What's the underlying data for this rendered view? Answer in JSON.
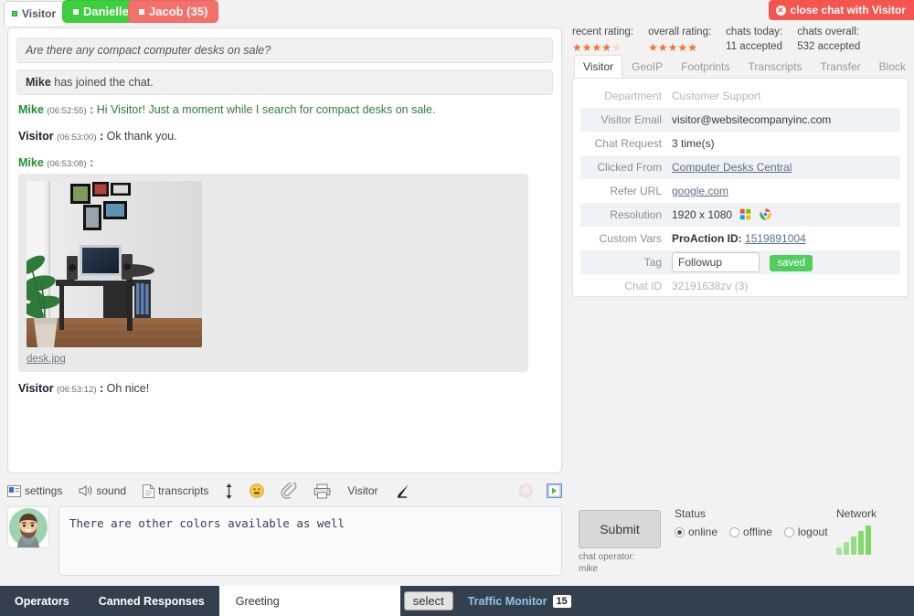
{
  "tabs": {
    "visitor_tab": "Visitor",
    "operators": [
      {
        "name": "Danielle",
        "count": "",
        "label": "Danielle",
        "color": "#3ecf3e"
      },
      {
        "name": "Jacob",
        "count": "35",
        "label": "Jacob (35)",
        "color": "#f4706b"
      }
    ]
  },
  "close_button": {
    "label": "close chat with Visitor",
    "prefix": "close chat with ",
    "strong": "Visitor"
  },
  "stats": {
    "recent_rating_label": "recent rating:",
    "recent_rating_value": 4,
    "overall_rating_label": "overall rating:",
    "overall_rating_value": 5,
    "chats_today_label": "chats today:",
    "chats_today_value": "11 accepted",
    "chats_overall_label": "chats overall:",
    "chats_overall_value": "532 accepted"
  },
  "panel": {
    "tabs": [
      "Visitor",
      "GeoIP",
      "Footprints",
      "Transcripts",
      "Transfer",
      "Block"
    ],
    "active_tab": "Visitor",
    "rows": [
      {
        "key": "Department",
        "value": "Customer Support",
        "muted": true
      },
      {
        "key": "Visitor Email",
        "value": "visitor@websitecompanyinc.com"
      },
      {
        "key": "Chat Request",
        "value": "3 time(s)"
      },
      {
        "key": "Clicked From",
        "value": "Computer Desks Central",
        "link": true
      },
      {
        "key": "Refer URL",
        "value": "google.com",
        "link": true
      },
      {
        "key": "Resolution",
        "value": "1920 x 1080",
        "icons": [
          "os-icon",
          "chrome-icon"
        ]
      },
      {
        "key": "Custom Vars",
        "value": "ProAction ID: ",
        "bold_prefix": "ProAction ID:",
        "link_value": "1519891004"
      },
      {
        "key": "Tag",
        "value": "Followup",
        "input": true,
        "saved_label": "saved"
      },
      {
        "key": "Chat ID",
        "value": "32191638zv  (3)",
        "muted": true
      }
    ]
  },
  "chat": {
    "system_lines": [
      {
        "text": "Are there any compact computer desks on sale?",
        "italic": true
      },
      {
        "who": "Mike",
        "text": " has joined the chat."
      }
    ],
    "messages": [
      {
        "who": "Mike",
        "role": "op",
        "time": "06:52:55",
        "text": "Hi Visitor! Just a moment while I search for compact desks on sale."
      },
      {
        "who": "Visitor",
        "role": "vis",
        "time": "06:53:00",
        "text": "Ok thank you."
      },
      {
        "who": "Mike",
        "role": "op",
        "time": "06:53:08",
        "text": "",
        "attachment": {
          "filename": "desk.jpg",
          "alt": "computer desk photo"
        }
      },
      {
        "who": "Visitor",
        "role": "vis",
        "time": "06:53:12",
        "text": "Oh nice!"
      }
    ]
  },
  "toolbar": {
    "settings": "settings",
    "sound": "sound",
    "transcripts": "transcripts",
    "visitor": "Visitor",
    "icons": [
      "settings-icon",
      "sound-icon",
      "transcripts-icon",
      "resize-icon",
      "emoji-icon",
      "attach-icon",
      "print-icon",
      "pen-icon",
      "bell-icon",
      "push-icon"
    ]
  },
  "composer": {
    "value": "There are other colors available as well",
    "placeholder": ""
  },
  "submit": {
    "label": "Submit",
    "operator_label_line1": "chat operator:",
    "operator_label_line2": "mike"
  },
  "status": {
    "label": "Status",
    "options": [
      {
        "label": "online",
        "selected": true
      },
      {
        "label": "offline",
        "selected": false
      },
      {
        "label": "logout",
        "selected": false
      }
    ]
  },
  "network": {
    "label": "Network",
    "bars": 5
  },
  "bottom_bar": {
    "operators": "Operators",
    "canned_responses": "Canned Responses",
    "selected_greeting": "Greeting",
    "select_button": "select",
    "traffic_monitor": "Traffic Monitor",
    "traffic_count": "15"
  },
  "colors": {
    "accent_green": "#3ecf3e",
    "accent_red": "#f4706b",
    "star": "#f1722c",
    "dark_bar": "#35404f",
    "traffic_text": "#8fc4e8"
  }
}
